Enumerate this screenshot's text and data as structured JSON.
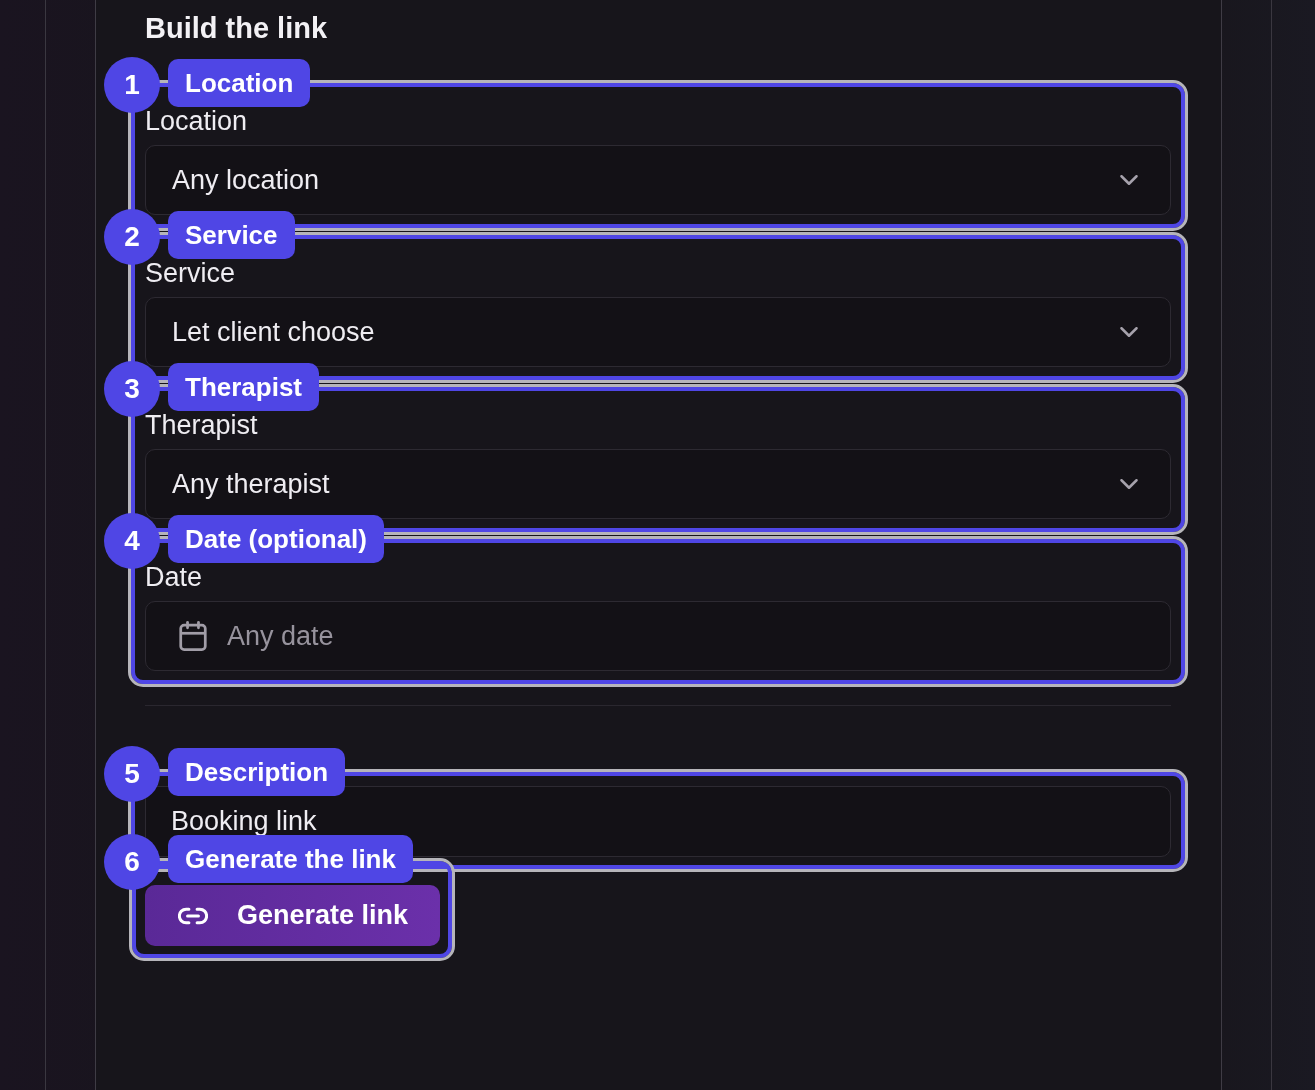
{
  "section_title": "Build the link",
  "fields": [
    {
      "kind": "select",
      "label": "Location",
      "value": "Any location",
      "annotation": {
        "number": "1",
        "label": "Location"
      }
    },
    {
      "kind": "select",
      "label": "Service",
      "value": "Let client choose",
      "annotation": {
        "number": "2",
        "label": "Service"
      }
    },
    {
      "kind": "select",
      "label": "Therapist",
      "value": "Any therapist",
      "annotation": {
        "number": "3",
        "label": "Therapist"
      }
    },
    {
      "kind": "date",
      "label": "Date",
      "placeholder": "Any date",
      "annotation": {
        "number": "4",
        "label": "Date (optional)"
      }
    }
  ],
  "description": {
    "value": "Booking link",
    "annotation": {
      "number": "5",
      "label": "Description"
    }
  },
  "generate_button": {
    "label": "Generate link",
    "annotation": {
      "number": "6",
      "label": "Generate the link"
    }
  }
}
